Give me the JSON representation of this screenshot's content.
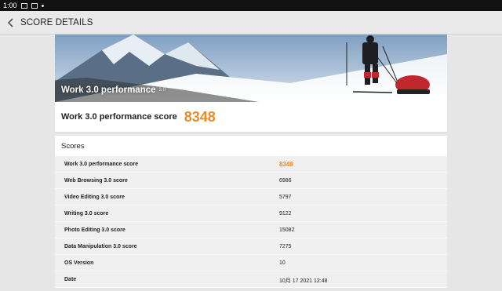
{
  "status_bar": {
    "time": "1:00"
  },
  "app_bar": {
    "title": "SCORE DETAILS"
  },
  "hero": {
    "title": "Work 3.0 performance",
    "version": "3.0"
  },
  "score_card": {
    "label": "Work 3.0 performance score",
    "value": "8348"
  },
  "scores_section": {
    "header": "Scores",
    "rows": [
      {
        "label": "Work 3.0 performance score",
        "value": "8348"
      },
      {
        "label": "Web Browsing 3.0 score",
        "value": "6986"
      },
      {
        "label": "Video Editing 3.0 score",
        "value": "5797"
      },
      {
        "label": "Writing 3.0 score",
        "value": "9122"
      },
      {
        "label": "Photo Editing 3.0 score",
        "value": "15082"
      },
      {
        "label": "Data Manipulation 3.0 score",
        "value": "7275"
      },
      {
        "label": "OS Version",
        "value": "10"
      },
      {
        "label": "Date",
        "value": "10月 17 2021 12:48"
      }
    ]
  },
  "colors": {
    "accent": "#f08a1e",
    "status_bar": "#111111",
    "app_bar": "#e9e9e9"
  }
}
